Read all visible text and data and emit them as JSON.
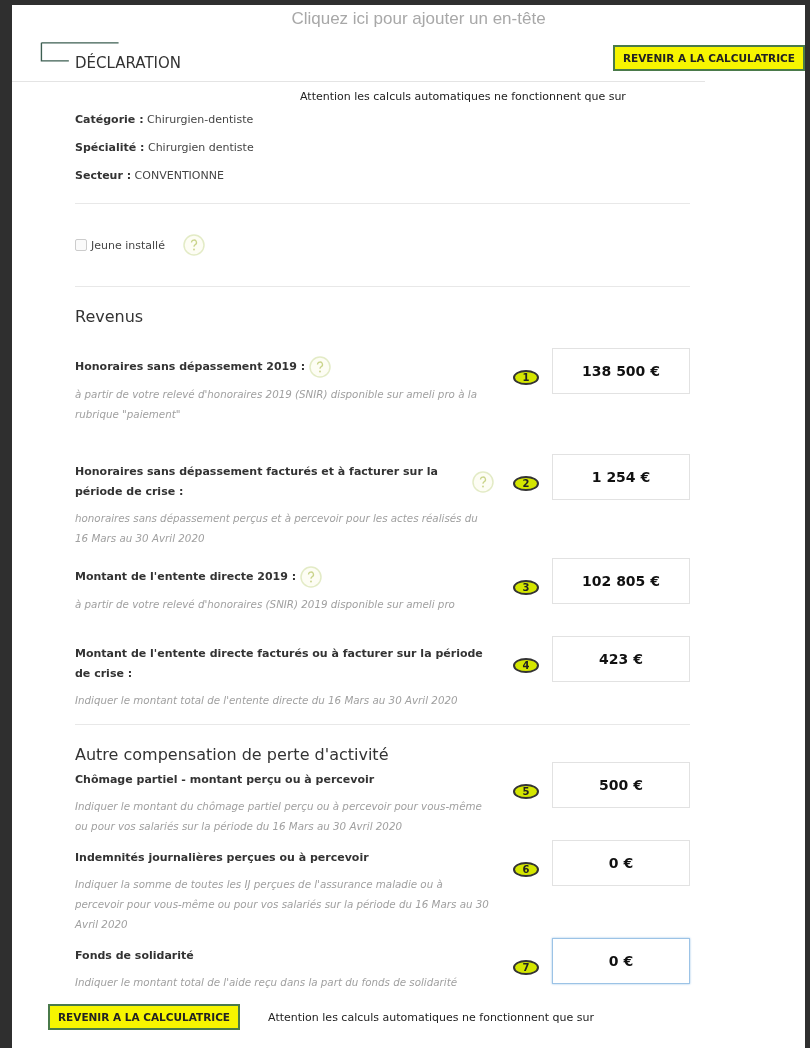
{
  "header_placeholder": "Cliquez ici pour ajouter un en-tête",
  "title": "DÉCLARATION",
  "top_button": "REVENIR A LA CALCULATRICE",
  "top_notice": "Attention les calculs automatiques ne fonctionnent que sur",
  "info": [
    {
      "label": "Catégorie :",
      "value": "Chirurgien-dentiste"
    },
    {
      "label": "Spécialité :",
      "value": "Chirurgien dentiste"
    },
    {
      "label": "Secteur :",
      "value": "CONVENTIONNE"
    }
  ],
  "jeune_installe": {
    "label": "Jeune installé",
    "checked": false
  },
  "sections": [
    {
      "title": "Revenus",
      "fields": [
        {
          "label": "Honoraires sans dépassement 2019 :",
          "help": true,
          "hint": "à partir de votre relevé d'honoraires 2019 (SNIR) disponible sur ameli pro à la rubrique \"paiement\"",
          "number": "1",
          "value": "138 500 €",
          "focused": false
        },
        {
          "label": "Honoraires sans dépassement facturés et à facturer sur la période de crise :",
          "help": true,
          "hint": "honoraires sans dépassement perçus et à percevoir pour les actes réalisés du 16 Mars au 30 Avril 2020",
          "number": "2",
          "value": "1 254 €",
          "focused": false
        },
        {
          "label": "Montant de l'entente directe 2019 :",
          "help": true,
          "hint": "à partir de votre relevé d'honoraires (SNIR) 2019 disponible sur ameli pro",
          "number": "3",
          "value": "102 805 €",
          "focused": false
        },
        {
          "label": "Montant de l'entente directe facturés ou à facturer sur la période de crise :",
          "help": false,
          "hint": "Indiquer le montant total de l'entente directe du 16 Mars au 30 Avril 2020",
          "number": "4",
          "value": "423 €",
          "focused": false
        }
      ]
    },
    {
      "title": "Autre compensation de perte d'activité",
      "fields": [
        {
          "label": "Chômage partiel - montant perçu ou à percevoir",
          "help": false,
          "hint": "Indiquer le montant du chômage partiel perçu ou à percevoir pour vous-même ou pour vos salariés sur la période du 16 Mars au 30 Avril 2020",
          "number": "5",
          "value": "500 €",
          "focused": false
        },
        {
          "label": "Indemnités journalières perçues ou à percevoir",
          "help": false,
          "hint": "Indiquer la somme de toutes les IJ perçues de l'assurance maladie ou à percevoir pour vous-même ou pour vos salariés sur la période du 16 Mars au 30 Avril 2020",
          "number": "6",
          "value": "0 €",
          "focused": false
        },
        {
          "label": "Fonds de solidarité",
          "help": false,
          "hint": "Indiquer le montant total de l'aide reçu dans la part du fonds de solidarité",
          "number": "7",
          "value": "0 €",
          "focused": true
        }
      ]
    }
  ],
  "bottom_button": "REVENIR A LA CALCULATRICE",
  "bottom_notice": "Attention les calculs automatiques ne fonctionnent que sur"
}
